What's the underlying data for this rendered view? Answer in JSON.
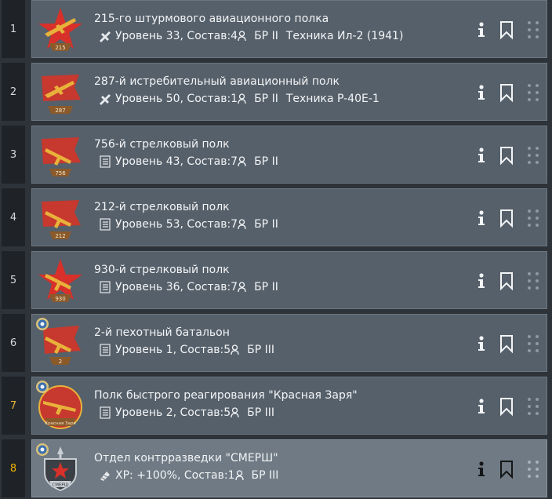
{
  "colors": {
    "card": "#56606a",
    "card_selected": "#6f7a84",
    "number_gold": "#e8b23a",
    "text": "#f2f4f6",
    "star_red": "#d8302a",
    "flag_red": "#c7382e"
  },
  "units": [
    {
      "number": "1",
      "title": "215-го штурмового авиационного полка",
      "type_icon": "plane-icon",
      "stats": "Уровень 33, Состав:4",
      "br": "БР II",
      "vehicle": "Техника Ил-2 (1941)",
      "emblem": "star-plane-emblem",
      "emblem_label": "215"
    },
    {
      "number": "2",
      "title": "287-й истребительный авиационный полк",
      "type_icon": "plane-icon",
      "stats": "Уровень 50, Состав:1",
      "br": "БР II",
      "vehicle": "Техника P-40E-1",
      "emblem": "flag-plane-emblem",
      "emblem_label": "287"
    },
    {
      "number": "3",
      "title": "756-й стрелковый полк",
      "type_icon": "infantry-icon",
      "stats": "Уровень 43, Состав:7",
      "br": "БР II",
      "vehicle": "",
      "emblem": "flag-gun-emblem",
      "emblem_label": "756"
    },
    {
      "number": "4",
      "title": "212-й стрелковый полк",
      "type_icon": "infantry-icon",
      "stats": "Уровень 53, Состав:7",
      "br": "БР II",
      "vehicle": "",
      "emblem": "flag-gun-emblem",
      "emblem_label": "212"
    },
    {
      "number": "5",
      "title": "930-й стрелковый полк",
      "type_icon": "infantry-icon",
      "stats": "Уровень 36, Состав:7",
      "br": "БР II",
      "vehicle": "",
      "emblem": "star-gun-emblem",
      "emblem_label": "930"
    },
    {
      "number": "6",
      "title": "2-й пехотный батальон",
      "type_icon": "infantry-icon",
      "stats": "Уровень 1, Состав:5",
      "br": "БР III",
      "vehicle": "",
      "emblem": "flag-gun-emblem",
      "emblem_label": "2",
      "medal": true
    },
    {
      "number": "7",
      "title": "Полк быстрого реагирования \"Красная Заря\"",
      "type_icon": "infantry-icon",
      "stats": "Уровень 2, Состав:5",
      "br": "БР III",
      "vehicle": "",
      "emblem": "wreath-gun-emblem",
      "emblem_label": "Красная Заря",
      "medal": true,
      "gold_number": true
    },
    {
      "number": "8",
      "title": "Отдел контрразведки \"СМЕРШ\"",
      "type_icon": "xp-boost-icon",
      "stats": "XP: +100%, Состав:1",
      "br": "БР III",
      "vehicle": "",
      "emblem": "shield-sword-emblem",
      "emblem_label": "СМЕРШ",
      "medal": true,
      "selected": true
    }
  ]
}
